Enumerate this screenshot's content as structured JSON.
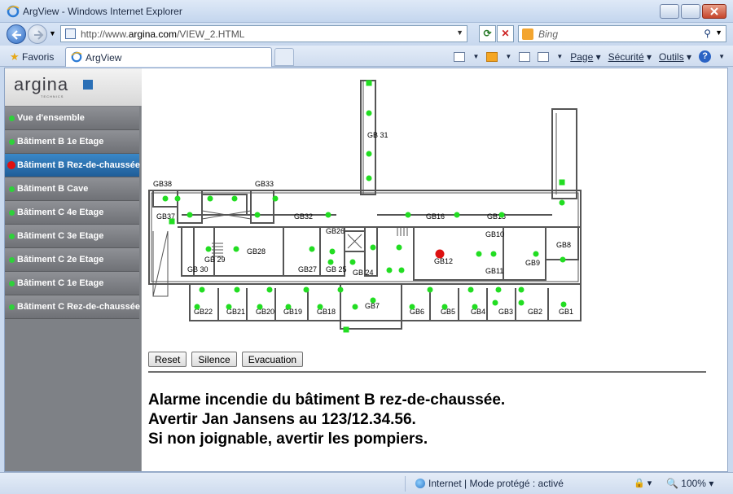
{
  "window": {
    "title": "ArgView - Windows Internet Explorer"
  },
  "address": {
    "url_prefix": "http://www.",
    "url_domain": "argina.com",
    "url_path": "/VIEW_2.HTML"
  },
  "search": {
    "placeholder": "Bing"
  },
  "favorites": {
    "label": "Favoris"
  },
  "tab": {
    "label": "ArgView"
  },
  "tools": {
    "page": "Page",
    "security": "Sécurité",
    "tools": "Outils"
  },
  "logo": {
    "word": "argina",
    "tagline": "TECHNICS"
  },
  "nav": {
    "items": [
      {
        "label": "Vue d'ensemble",
        "status": "ok"
      },
      {
        "label": "Bâtiment B 1e Etage",
        "status": "ok"
      },
      {
        "label": "Bâtiment B Rez-de-chaussée",
        "status": "alarm"
      },
      {
        "label": "Bâtiment B Cave",
        "status": "ok"
      },
      {
        "label": "Bâtiment C 4e Etage",
        "status": "ok"
      },
      {
        "label": "Bâtiment C 3e Etage",
        "status": "ok"
      },
      {
        "label": "Bâtiment C 2e Etage",
        "status": "ok"
      },
      {
        "label": "Bâtiment C 1e Etage",
        "status": "ok"
      },
      {
        "label": "Bâtiment C Rez-de-chaussée",
        "status": "ok"
      }
    ]
  },
  "plan": {
    "rooms": [
      "GB38",
      "GB33",
      "GB37",
      "GB32",
      "GB16",
      "GB15",
      "GB26",
      "GB10",
      "GB8",
      "GB28",
      "GB27",
      "GB12",
      "GB11",
      "GB9",
      "GB 31",
      "GB 29",
      "GB 30",
      "GB 25",
      "GB 24",
      "GB7",
      "GB22",
      "GB21",
      "GB20",
      "GB19",
      "GB18",
      "GB6",
      "GB5",
      "GB4",
      "GB3",
      "GB2",
      "GB1"
    ],
    "alarm_detector": "GB12",
    "colors": {
      "ok": "#22dd22",
      "alarm": "#dd1111",
      "wall": "#555555"
    }
  },
  "buttons": {
    "reset": "Reset",
    "silence": "Silence",
    "evacuation": "Evacuation"
  },
  "message": {
    "line1": "Alarme incendie du bâtiment B rez-de-chaussée.",
    "line2": "Avertir Jan Jansens au 123/12.34.56.",
    "line3": "Si non joignable, avertir les pompiers."
  },
  "status": {
    "zone": "Internet | Mode protégé : activé",
    "zoom": "100%"
  }
}
